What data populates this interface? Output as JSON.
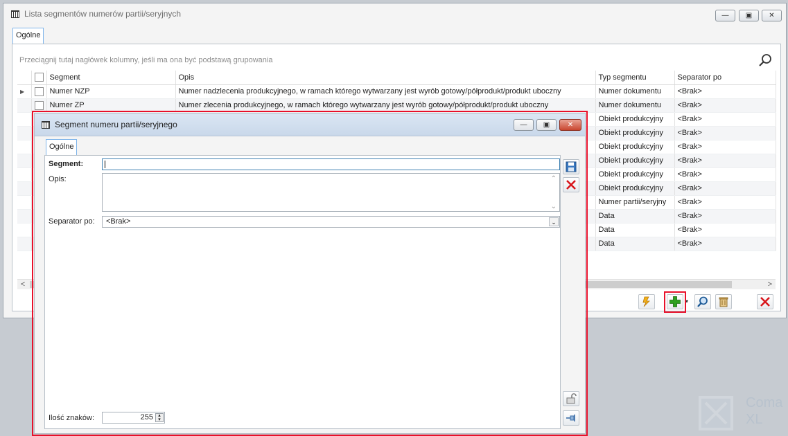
{
  "main_window": {
    "title": "Lista segmentów numerów partii/seryjnych",
    "tab": "Ogólne",
    "group_hint": "Przeciągnij tutaj nagłówek kolumny, jeśli ma ona być podstawą grupowania",
    "columns": [
      "Segment",
      "Opis",
      "Typ segmentu",
      "Separator po"
    ],
    "rows": [
      {
        "segment": "Numer NZP",
        "opis": "Numer nadzlecenia produkcyjnego, w ramach którego wytwarzany jest wyrób gotowy/półprodukt/produkt uboczny",
        "typ": "Numer dokumentu",
        "separator": "<Brak>"
      },
      {
        "segment": "Numer ZP",
        "opis": "Numer zlecenia produkcyjnego, w ramach którego wytwarzany jest wyrób gotowy/półprodukt/produkt uboczny",
        "typ": "Numer dokumentu",
        "separator": "<Brak>"
      },
      {
        "segment": "",
        "opis": "",
        "typ": "Obiekt produkcyjny",
        "separator": "<Brak>"
      },
      {
        "segment": "",
        "opis": "",
        "typ": "Obiekt produkcyjny",
        "separator": "<Brak>"
      },
      {
        "segment": "",
        "opis": "",
        "typ": "Obiekt produkcyjny",
        "separator": "<Brak>"
      },
      {
        "segment": "",
        "opis": "",
        "typ": "Obiekt produkcyjny",
        "separator": "<Brak>"
      },
      {
        "segment": "",
        "opis": "",
        "typ": "Obiekt produkcyjny",
        "separator": "<Brak>"
      },
      {
        "segment": "",
        "opis": "",
        "typ": "Obiekt produkcyjny",
        "separator": "<Brak>"
      },
      {
        "segment": "",
        "opis": "",
        "typ": "Numer partii/seryjny",
        "separator": "<Brak>"
      },
      {
        "segment": "",
        "opis": "",
        "typ": "Data",
        "separator": "<Brak>"
      },
      {
        "segment": "",
        "opis": "",
        "typ": "Data",
        "separator": "<Brak>"
      },
      {
        "segment": "",
        "opis": "",
        "typ": "Data",
        "separator": "<Brak>"
      }
    ]
  },
  "dialog": {
    "title": "Segment numeru partii/seryjnego",
    "tab": "Ogólne",
    "segment_label": "Segment:",
    "segment_value": "",
    "opis_label": "Opis:",
    "opis_value": "",
    "separator_label": "Separator po:",
    "separator_value": "<Brak>",
    "ilosc_label": "Ilość znaków:",
    "ilosc_value": "255"
  },
  "watermark": {
    "line1": "Coma",
    "line2": "XL"
  },
  "colors": {
    "highlight": "#e8102a",
    "tab_border": "#7eb4ea",
    "add_green": "#2ea01f",
    "delete_red": "#d8151b"
  }
}
